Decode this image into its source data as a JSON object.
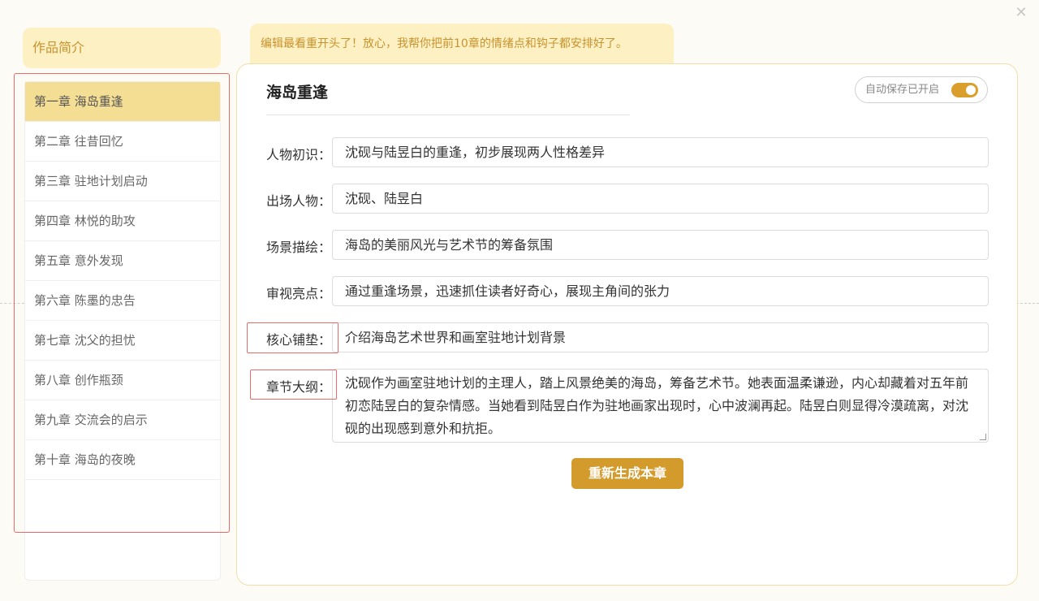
{
  "close_icon": "close-icon",
  "intro_button": "作品简介",
  "tip_message": "编辑最看重开头了！放心，我帮你把前10章的情绪点和钩子都安排好了。",
  "chapters": [
    {
      "label": "第一章 海岛重逢",
      "active": true
    },
    {
      "label": "第二章 往昔回忆",
      "active": false
    },
    {
      "label": "第三章 驻地计划启动",
      "active": false
    },
    {
      "label": "第四章 林悦的助攻",
      "active": false
    },
    {
      "label": "第五章 意外发现",
      "active": false
    },
    {
      "label": "第六章 陈墨的忠告",
      "active": false
    },
    {
      "label": "第七章 沈父的担忧",
      "active": false
    },
    {
      "label": "第八章 创作瓶颈",
      "active": false
    },
    {
      "label": "第九章 交流会的启示",
      "active": false
    },
    {
      "label": "第十章 海岛的夜晚",
      "active": false
    }
  ],
  "editor": {
    "title": "海岛重逢",
    "autosave_label": "自动保存已开启",
    "autosave_on": true,
    "fields": [
      {
        "label": "人物初识：",
        "value": "沈砚与陆昱白的重逢，初步展现两人性格差异"
      },
      {
        "label": "出场人物：",
        "value": "沈砚、陆昱白"
      },
      {
        "label": "场景描绘：",
        "value": "海岛的美丽风光与艺术节的筹备氛围"
      },
      {
        "label": "审视亮点：",
        "value": "通过重逢场景，迅速抓住读者好奇心，展现主角间的张力"
      },
      {
        "label": "核心铺垫：",
        "value": "介绍海岛艺术世界和画室驻地计划背景"
      }
    ],
    "outline": {
      "label": "章节大纲：",
      "value": "沈砚作为画室驻地计划的主理人，踏上风景绝美的海岛，筹备艺术节。她表面温柔谦逊，内心却藏着对五年前初恋陆昱白的复杂情感。当她看到陆昱白作为驻地画家出现时，心中波澜再起。陆昱白则显得冷漠疏离，对沈砚的出现感到意外和抗拒。"
    },
    "regenerate_label": "重新生成本章"
  },
  "colors": {
    "accent": "#d39a2c",
    "active_chapter_bg": "#f4de94",
    "tip_bg": "#fdf1c4",
    "highlight": "#e86a6a"
  }
}
